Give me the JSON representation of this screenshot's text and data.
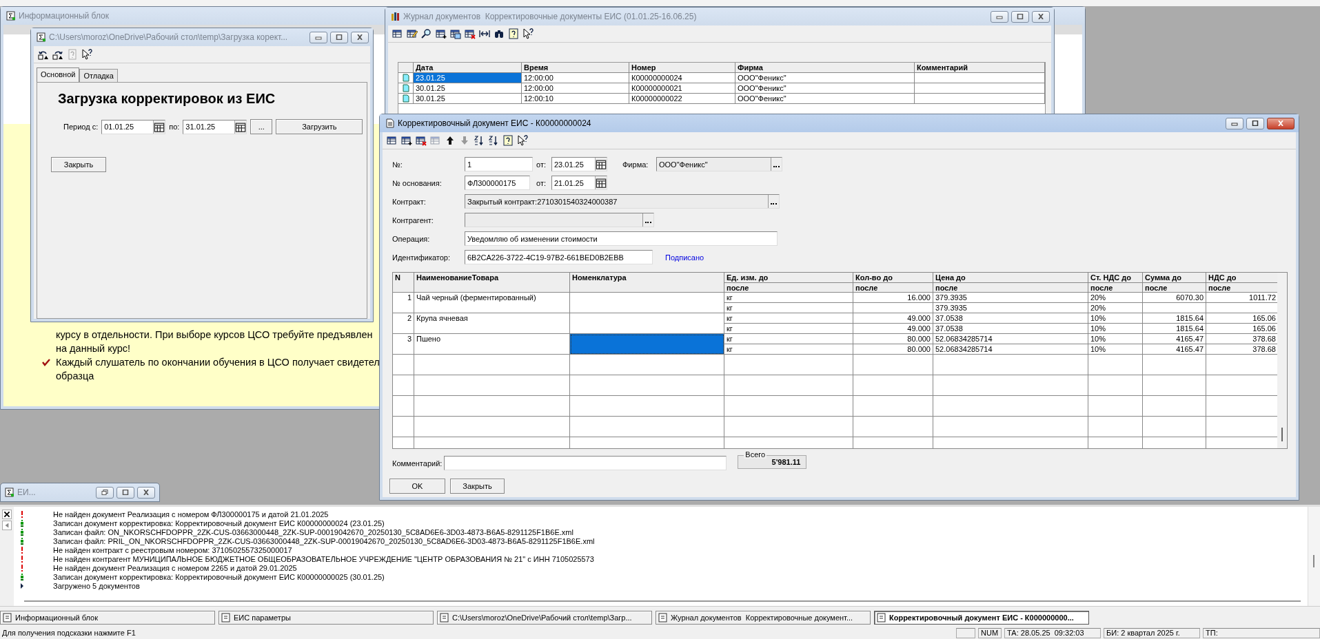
{
  "info_window": {
    "title": "Информационный блок",
    "lines": [
      {
        "kind": "text",
        "text": "курсу в отдельности. При выборе курсов ЦСО требуйте предъявлен"
      },
      {
        "kind": "text",
        "text": "на данный курс!"
      },
      {
        "kind": "bullet",
        "text": "Каждый слушатель по окончании обучения в ЦСО получает свидетел"
      },
      {
        "kind": "text",
        "text": "образца"
      }
    ]
  },
  "load_window": {
    "title": "C:\\Users\\moroz\\OneDrive\\Рабочий стол\\temp\\Загрузка корект...",
    "tabs": [
      {
        "label": "Основной",
        "selected": true
      },
      {
        "label": "Отладка",
        "selected": false
      }
    ],
    "heading": "Загрузка корректировок из ЕИС",
    "from_label": "Период с:",
    "from": "01.01.25",
    "to_label": "по:",
    "to": "31.01.25",
    "dots_button": "...",
    "load_button": "Загрузить",
    "close_button": "Закрыть"
  },
  "journal_window": {
    "title": "Журнал документов  Корректировочные документы ЕИС (01.01.25-16.06.25)",
    "columns": [
      "Дата",
      "Время",
      "Номер",
      "Фирма",
      "Комментарий"
    ],
    "rows": [
      {
        "selected": true,
        "cells": [
          "23.01.25",
          "12:00:00",
          "К00000000024",
          "ООО\"Феникс\""
        ]
      },
      {
        "selected": false,
        "cells": [
          "30.01.25",
          "12:00:00",
          "К00000000021",
          "ООО\"Феникс\""
        ]
      },
      {
        "selected": false,
        "cells": [
          "30.01.25",
          "12:00:10",
          "К00000000022",
          "ООО\"Феникс\""
        ]
      }
    ]
  },
  "document_window": {
    "title": "Корректировочный документ ЕИС - К00000000024",
    "number_label": "№:",
    "number": "1",
    "date_label": "от:",
    "date": "23.01.25",
    "firm_label": "Фирма:",
    "firm": "ООО\"Феникс\"",
    "basis_label": "№ основания:",
    "basis": "ФЛ300000175",
    "basis_date_label": "от:",
    "basis_date": "21.01.25",
    "contract_label": "Контракт:",
    "contract": "Закрытый контракт:2710301540324000387",
    "counterparty_label": "Контрагент:",
    "counterparty_disabled": true,
    "operation_label": "Операция:",
    "operation": "Уведомляю об изменении стоимости",
    "id_label": "Идентификатор:",
    "id": "6B2CA226-3722-4C19-97B2-661BED0B2EBB",
    "signed_link": "Подписано",
    "columns": [
      {
        "top": "N"
      },
      {
        "top": "НаименованиеТовара"
      },
      {
        "top": "Номенклатура"
      },
      {
        "top": "Ед. изм. до",
        "bottom": "после"
      },
      {
        "top": "Кол-во до",
        "bottom": "после"
      },
      {
        "top": "Цена до",
        "bottom": "после"
      },
      {
        "top": "Ст. НДС до",
        "bottom": "после"
      },
      {
        "top": "Сумма до",
        "bottom": "после"
      },
      {
        "top": "НДС до",
        "bottom": "после"
      }
    ],
    "rows": [
      {
        "n": "1",
        "name": "Чай черный (ферментированный)",
        "selected": false,
        "values": [
          [
            "кг",
            "кг"
          ],
          [
            "16.000"
          ],
          [
            "379.3935",
            "379.3935"
          ],
          [
            "20%",
            "20%"
          ],
          [
            "6070.30"
          ],
          [
            "1011.72"
          ]
        ]
      },
      {
        "n": "2",
        "name": "Крупа ячневая",
        "selected": false,
        "values": [
          [
            "кг",
            "кг"
          ],
          [
            "49.000",
            "49.000"
          ],
          [
            "37.0538",
            "37.0538"
          ],
          [
            "10%",
            "10%"
          ],
          [
            "1815.64",
            "1815.64"
          ],
          [
            "165.06",
            "165.06"
          ]
        ]
      },
      {
        "n": "3",
        "name": "Пшено",
        "selected": true,
        "values": [
          [
            "кг",
            "кг"
          ],
          [
            "80.000",
            "80.000"
          ],
          [
            "52.06834285714",
            "52.06834285714"
          ],
          [
            "10%",
            "10%"
          ],
          [
            "4165.47",
            "4165.47"
          ],
          [
            "378.68",
            "378.68"
          ]
        ]
      }
    ],
    "comment_label": "Комментарий:",
    "total_label": "Всего",
    "total": "5'981.11",
    "ok_button": "OK",
    "close_button": "Закрыть"
  },
  "minimized_window": {
    "title": "ЕИ..."
  },
  "log": [
    {
      "kind": "error",
      "text": "Не найден документ Реализация с номером ФЛ300000175 и датой 21.01.2025"
    },
    {
      "kind": "ok",
      "text": "Записан документ корректировка: Корректировочный документ ЕИС К00000000024 (23.01.25)"
    },
    {
      "kind": "ok",
      "text": "Записан файл: ON_NKORSCHFDOPPR_2ZK-CUS-03663000448_2ZK-SUP-00019042670_20250130_5C8AD6E6-3D03-4873-B6A5-8291125F1B6E.xml"
    },
    {
      "kind": "ok",
      "text": "Записан файл: PRIL_ON_NKORSCHFDOPPR_2ZK-CUS-03663000448_2ZK-SUP-00019042670_20250130_5C8AD6E6-3D03-4873-B6A5-8291125F1B6E.xml"
    },
    {
      "kind": "error",
      "text": "Не найден контракт с реестровым номером: 3710502557325000017"
    },
    {
      "kind": "error",
      "text": "Не найден контрагент МУНИЦИПАЛЬНОЕ БЮДЖЕТНОЕ ОБЩЕОБРАЗОВАТЕЛЬНОЕ УЧРЕЖДЕНИЕ \"ЦЕНТР ОБРАЗОВАНИЯ № 21\" с ИНН 7105025573"
    },
    {
      "kind": "error",
      "text": "Не найден документ Реализация с номером 2265 и датой 29.01.2025"
    },
    {
      "kind": "ok",
      "text": "Записан документ корректировка: Корректировочный документ ЕИС К00000000025 (30.01.25)"
    },
    {
      "kind": "info",
      "text": "Загружено 5 документов"
    }
  ],
  "taskbar": [
    {
      "label": "Информационный блок",
      "selected": false
    },
    {
      "label": "ЕИС параметры",
      "selected": false
    },
    {
      "label": "C:\\Users\\moroz\\OneDrive\\Рабочий стол\\temp\\Загр...",
      "selected": false
    },
    {
      "label": "Журнал документов  Корректировочные документ...",
      "selected": false
    },
    {
      "label": "Корректировочный документ ЕИС - К000000000...",
      "selected": true
    }
  ],
  "status_bar": {
    "hint": "Для получения подсказки нажмите F1",
    "num": "NUM",
    "ta": "ТА: 28.05.25  09:32:03",
    "bi": "БИ: 2 квартал 2025 г.",
    "tp": "ТП:"
  }
}
